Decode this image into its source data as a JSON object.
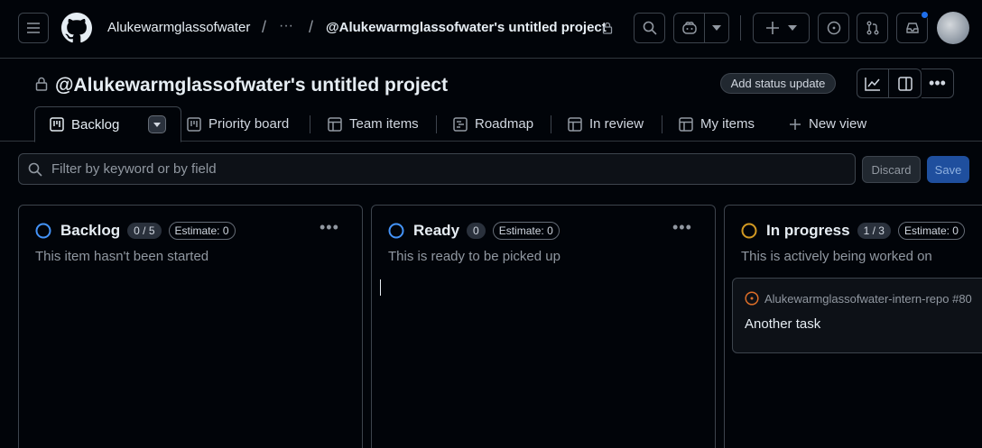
{
  "header": {
    "owner": "Alukewarmglassofwater",
    "ellipsis": "···",
    "project_crumb": "@Alukewarmglassofwater's untitled project",
    "separator": "/"
  },
  "project": {
    "title": "@Alukewarmglassofwater's untitled project",
    "status_button": "Add status update"
  },
  "tabs": [
    {
      "label": "Backlog",
      "icon": "board-icon",
      "active": true
    },
    {
      "label": "Priority board",
      "icon": "board-icon"
    },
    {
      "label": "Team items",
      "icon": "table-icon"
    },
    {
      "label": "Roadmap",
      "icon": "roadmap-icon"
    },
    {
      "label": "In review",
      "icon": "table-icon"
    },
    {
      "label": "My items",
      "icon": "table-icon"
    },
    {
      "label": "New view",
      "icon": "plus-icon"
    }
  ],
  "filter": {
    "placeholder": "Filter by keyword or by field",
    "discard": "Discard",
    "save": "Save"
  },
  "columns": [
    {
      "name": "Backlog",
      "count": "0 / 5",
      "estimate": "Estimate: 0",
      "description": "This item hasn't been started",
      "status_color": "#4493f8"
    },
    {
      "name": "Ready",
      "count": "0",
      "estimate": "Estimate: 0",
      "description": "This is ready to be picked up",
      "status_color": "#4493f8"
    },
    {
      "name": "In progress",
      "count": "1 / 3",
      "estimate": "Estimate: 0",
      "description": "This is actively being worked on",
      "status_color": "#d29922",
      "cards": [
        {
          "repo": "Alukewarmglassofwater-intern-repo #80",
          "title": "Another task",
          "icon_color": "#db6d28"
        }
      ]
    }
  ],
  "colors": {
    "accent": "#1f6feb",
    "notification": "#1f6feb"
  }
}
